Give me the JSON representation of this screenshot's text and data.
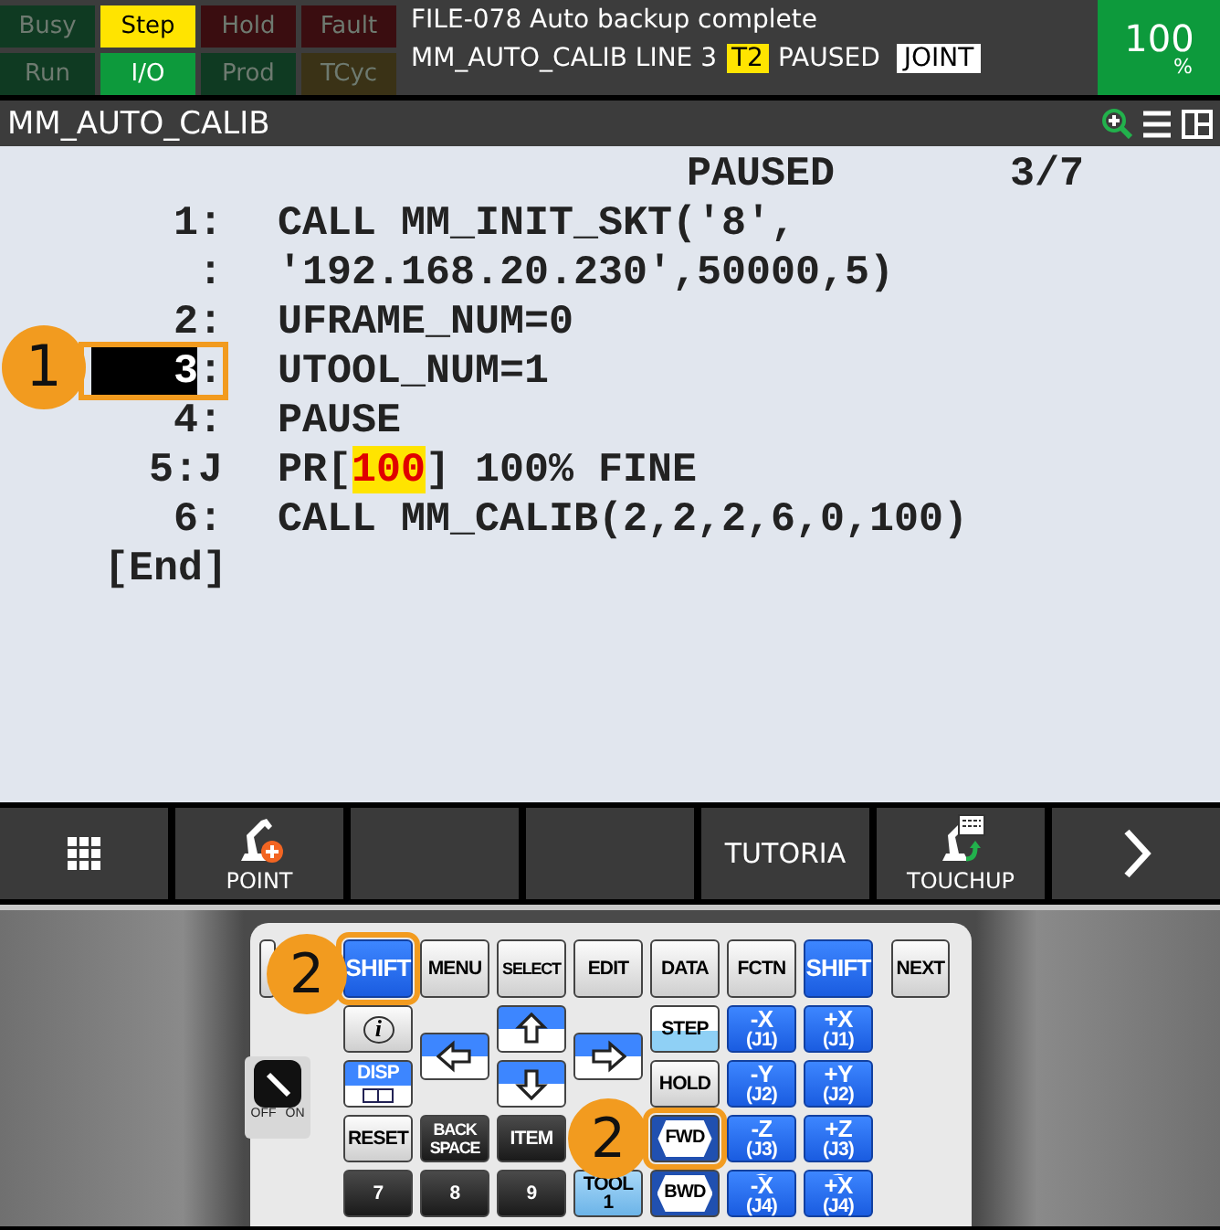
{
  "status_lamps": [
    {
      "label": "Busy",
      "on": false,
      "color": "#0f3a22"
    },
    {
      "label": "Step",
      "on": true,
      "color": "#ffe400"
    },
    {
      "label": "Hold",
      "on": false,
      "color": "#3a0d10"
    },
    {
      "label": "Fault",
      "on": false,
      "color": "#3a0d10"
    },
    {
      "label": "Run",
      "on": false,
      "color": "#0f3a22"
    },
    {
      "label": "I/O",
      "on": true,
      "color": "#0d9a3c"
    },
    {
      "label": "Prod",
      "on": false,
      "color": "#0f3a22"
    },
    {
      "label": "TCyc",
      "on": false,
      "color": "#3a3216"
    }
  ],
  "message": {
    "text": "FILE-078 Auto backup complete",
    "status": [
      {
        "kind": "plain",
        "text": "MM_AUTO_CALIB LINE 3"
      },
      {
        "kind": "tag",
        "text": "T2"
      },
      {
        "kind": "plain",
        "text": "PAUSED"
      },
      {
        "kind": "box",
        "text": "JOINT"
      }
    ]
  },
  "override": {
    "value": "100",
    "unit": "%"
  },
  "title": "MM_AUTO_CALIB",
  "program": {
    "state": "PAUSED",
    "position": "3/7",
    "end": "[End]",
    "lines": [
      {
        "number": "1",
        "marker": ":",
        "selected": false,
        "highlighted": false,
        "segments": [
          {
            "text": "CALL MM_INIT_SKT('8',",
            "highlight": false
          }
        ]
      },
      {
        "marker": ":",
        "selected": false,
        "highlighted": false,
        "segments": [
          {
            "text": "'192.168.20.230',50000,5)",
            "highlight": false
          }
        ]
      },
      {
        "number": "2",
        "marker": ":",
        "selected": false,
        "highlighted": false,
        "segments": [
          {
            "text": "UFRAME_NUM=0",
            "highlight": false
          }
        ]
      },
      {
        "number": "3",
        "marker": ":",
        "selected": true,
        "highlighted": true,
        "segments": [
          {
            "text": "UTOOL_NUM=1",
            "highlight": false
          }
        ]
      },
      {
        "number": "4",
        "marker": ":",
        "selected": false,
        "highlighted": false,
        "segments": [
          {
            "text": "PAUSE",
            "highlight": false
          }
        ]
      },
      {
        "number": "5",
        "marker": ":J",
        "selected": false,
        "highlighted": false,
        "segments": [
          {
            "text": " PR[",
            "highlight": false
          },
          {
            "text": "100",
            "highlight": true
          },
          {
            "text": "] 100% FINE",
            "highlight": false
          }
        ]
      },
      {
        "number": "6",
        "marker": ":",
        "selected": false,
        "highlighted": false,
        "segments": [
          {
            "text": "CALL MM_CALIB(2,2,2,6,0,100)",
            "highlight": false
          }
        ]
      }
    ]
  },
  "function_keys": [
    {
      "kind": "grid"
    },
    {
      "kind": "robot-add",
      "label": "POINT"
    },
    {
      "kind": "blank"
    },
    {
      "kind": "blank"
    },
    {
      "kind": "text",
      "label": "TUTORIA"
    },
    {
      "kind": "robot-touchup",
      "label": "TOUCHUP"
    },
    {
      "kind": "next"
    }
  ],
  "key_switch": {
    "labels": [
      "OFF",
      "ON"
    ],
    "on": true
  },
  "keys": [
    {
      "kind": "gray",
      "highlighted": false
    },
    {
      "kind": "blue",
      "label": "SHIFT",
      "highlighted": true
    },
    {
      "kind": "gray",
      "label": "MENU",
      "highlighted": false
    },
    {
      "kind": "gray",
      "label": "SELECT",
      "highlighted": false
    },
    {
      "kind": "gray",
      "label": "EDIT",
      "highlighted": false
    },
    {
      "kind": "gray",
      "label": "DATA",
      "highlighted": false
    },
    {
      "kind": "gray",
      "label": "FCTN",
      "highlighted": false
    },
    {
      "kind": "blue",
      "label": "SHIFT",
      "highlighted": false
    },
    {
      "kind": "gray",
      "label": "NEXT",
      "highlighted": false
    },
    {
      "kind": "info",
      "label": "i",
      "highlighted": false
    },
    {
      "kind": "arrow-up",
      "highlighted": false
    },
    {
      "kind": "step",
      "label": "STEP",
      "highlighted": false
    },
    {
      "kind": "blue",
      "label": "-X",
      "sub": "(J1)",
      "highlighted": false
    },
    {
      "kind": "blue",
      "label": "+X",
      "sub": "(J1)",
      "highlighted": false
    },
    {
      "kind": "arrow-left",
      "highlighted": false
    },
    {
      "kind": "arrow-right",
      "highlighted": false
    },
    {
      "kind": "disp",
      "label": "DISP",
      "highlighted": false
    },
    {
      "kind": "arrow-down",
      "highlighted": false
    },
    {
      "kind": "gray",
      "label": "HOLD",
      "highlighted": false
    },
    {
      "kind": "blue",
      "label": "-Y",
      "sub": "(J2)",
      "highlighted": false
    },
    {
      "kind": "blue",
      "label": "+Y",
      "sub": "(J2)",
      "highlighted": false
    },
    {
      "kind": "gray",
      "label": "RESET",
      "highlighted": false
    },
    {
      "kind": "dark",
      "label": "BACK SPACE",
      "highlighted": false
    },
    {
      "kind": "dark",
      "label": "ITEM",
      "highlighted": false
    },
    {
      "kind": "hex",
      "label": "FWD",
      "highlighted": true
    },
    {
      "kind": "blue",
      "label": "-Z",
      "sub": "(J3)",
      "highlighted": false
    },
    {
      "kind": "blue",
      "label": "+Z",
      "sub": "(J3)",
      "highlighted": false
    },
    {
      "kind": "dark",
      "label": "7",
      "highlighted": false
    },
    {
      "kind": "dark",
      "label": "8",
      "highlighted": false
    },
    {
      "kind": "dark",
      "label": "9",
      "highlighted": false
    },
    {
      "kind": "lightblue",
      "label": "TOOL",
      "sub": "1",
      "highlighted": false
    },
    {
      "kind": "hex",
      "label": "BWD",
      "highlighted": false
    },
    {
      "kind": "rotate",
      "label": "-X",
      "sub": "(J4)",
      "highlighted": false
    },
    {
      "kind": "rotate",
      "label": "+X",
      "sub": "(J4)",
      "highlighted": false
    }
  ],
  "badges": [
    {
      "text": "1"
    },
    {
      "text": "2"
    },
    {
      "text": "2"
    }
  ]
}
